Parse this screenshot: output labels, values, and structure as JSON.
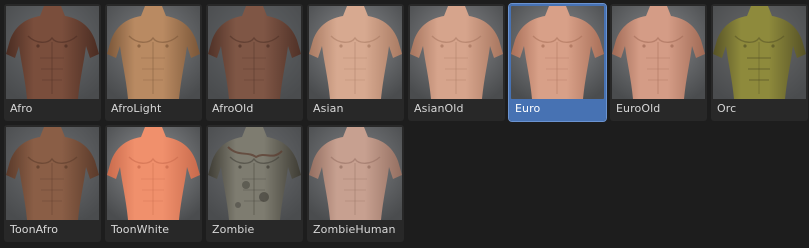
{
  "browser": {
    "items": [
      {
        "label": "Afro",
        "skin": "#7a4e3c",
        "shade": "#4a2c22",
        "bg": "#6a6d70",
        "selected": false
      },
      {
        "label": "AfroLight",
        "skin": "#b98a62",
        "shade": "#7a5638",
        "bg": "#7d7f82",
        "selected": false
      },
      {
        "label": "AfroOld",
        "skin": "#7f5645",
        "shade": "#4f3127",
        "bg": "#626568",
        "selected": false
      },
      {
        "label": "Asian",
        "skin": "#d7a990",
        "shade": "#a87a62",
        "bg": "#8a8c8f",
        "selected": false
      },
      {
        "label": "AsianOld",
        "skin": "#d6a48c",
        "shade": "#a6755e",
        "bg": "#88898c",
        "selected": false
      },
      {
        "label": "Euro",
        "skin": "#d8a088",
        "shade": "#a86f58",
        "bg": "#8b8d90",
        "selected": true
      },
      {
        "label": "EuroOld",
        "skin": "#d49c86",
        "shade": "#a06a55",
        "bg": "#87898c",
        "selected": false
      },
      {
        "label": "Orc",
        "skin": "#8e8a3c",
        "shade": "#565226",
        "bg": "#6a6b6c",
        "selected": false
      },
      {
        "label": "ToonAfro",
        "skin": "#8a5e46",
        "shade": "#5a3a2a",
        "bg": "#6e7073",
        "selected": false
      },
      {
        "label": "ToonWhite",
        "skin": "#f0906c",
        "shade": "#c86a4c",
        "bg": "#8f9194",
        "selected": false
      },
      {
        "label": "Zombie",
        "skin": "#7e7c70",
        "shade": "#3e3c34",
        "bg": "#6b6d70",
        "selected": false
      },
      {
        "label": "ZombieHuman",
        "skin": "#c7a090",
        "shade": "#936e60",
        "bg": "#808285",
        "selected": false
      }
    ]
  }
}
